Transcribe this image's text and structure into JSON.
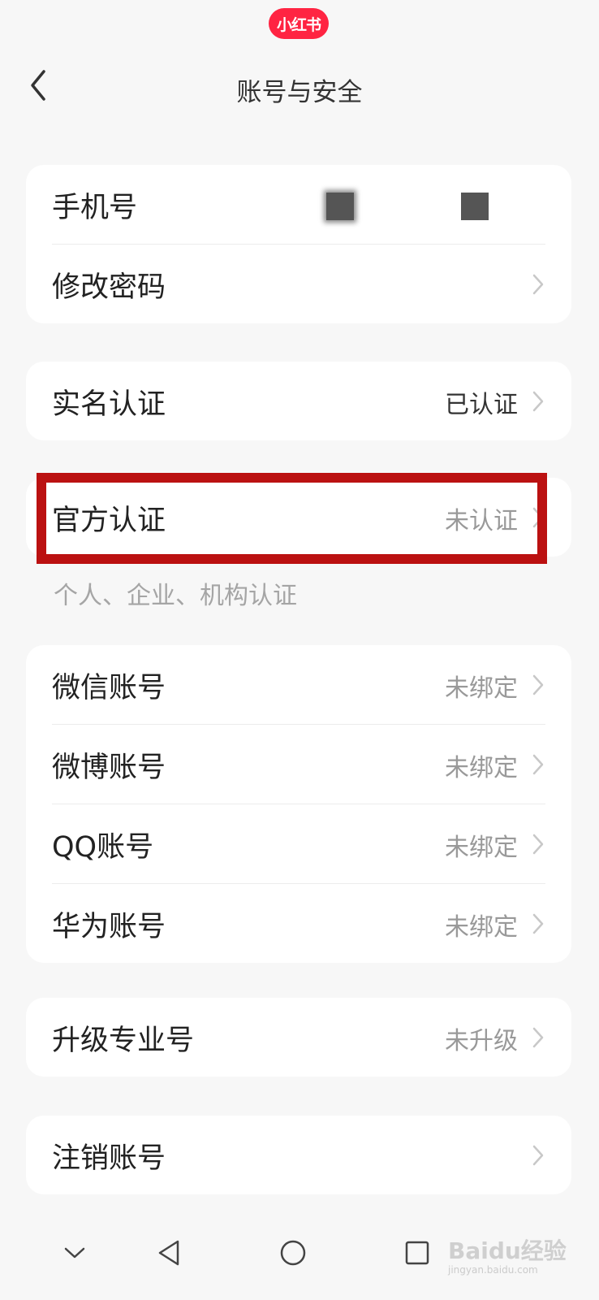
{
  "app": {
    "logo_text": "小红书",
    "brand_color": "#ff2442"
  },
  "header": {
    "title": "账号与安全"
  },
  "sections": {
    "phone": {
      "label": "手机号"
    },
    "password": {
      "label": "修改密码"
    },
    "realname": {
      "label": "实名认证",
      "value": "已认证"
    },
    "official": {
      "label": "官方认证",
      "value": "未认证",
      "hint": "个人、企业、机构认证"
    },
    "wechat": {
      "label": "微信账号",
      "value": "未绑定"
    },
    "weibo": {
      "label": "微博账号",
      "value": "未绑定"
    },
    "qq": {
      "label": "QQ账号",
      "value": "未绑定"
    },
    "huawei": {
      "label": "华为账号",
      "value": "未绑定"
    },
    "pro": {
      "label": "升级专业号",
      "value": "未升级"
    },
    "delete": {
      "label": "注销账号"
    }
  },
  "highlight_color": "#bb1111",
  "watermark": {
    "text": "Baidu经验",
    "sub": "jingyan.baidu.com"
  },
  "icons": {
    "back": "chevron-left-icon",
    "row": "chevron-right-icon",
    "nav": [
      "nav-collapse-icon",
      "nav-back-icon",
      "nav-home-icon",
      "nav-recents-icon"
    ]
  }
}
